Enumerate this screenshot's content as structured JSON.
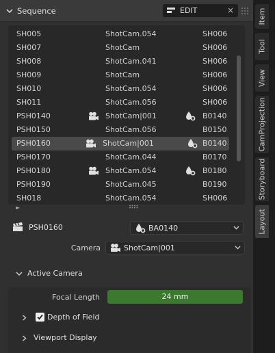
{
  "panel": {
    "title": "Sequence",
    "field_value": "EDIT",
    "field_clear": "×"
  },
  "list": {
    "rows": [
      {
        "shot": "SH005",
        "camera": "ShotCam.054",
        "bg": "SH006",
        "cam_icon": false,
        "bg_icon": false
      },
      {
        "shot": "SH007",
        "camera": "ShotCam",
        "bg": "SH006",
        "cam_icon": false,
        "bg_icon": false
      },
      {
        "shot": "SH008",
        "camera": "ShotCam.041",
        "bg": "SH006",
        "cam_icon": false,
        "bg_icon": false
      },
      {
        "shot": "SH009",
        "camera": "ShotCam",
        "bg": "SH006",
        "cam_icon": false,
        "bg_icon": false
      },
      {
        "shot": "SH010",
        "camera": "ShotCam.054",
        "bg": "SH006",
        "cam_icon": false,
        "bg_icon": false
      },
      {
        "shot": "SH011",
        "camera": "ShotCam.056",
        "bg": "SH006",
        "cam_icon": false,
        "bg_icon": false
      },
      {
        "shot": "PSH0140",
        "camera": "ShotCam|001",
        "bg": "B0140",
        "cam_icon": true,
        "bg_icon": true
      },
      {
        "shot": "PSH0150",
        "camera": "ShotCam.056",
        "bg": "B0150",
        "cam_icon": false,
        "bg_icon": false
      },
      {
        "shot": "PSH0160",
        "camera": "ShotCam|001",
        "bg": "B0140",
        "cam_icon": true,
        "bg_icon": true,
        "selected": true
      },
      {
        "shot": "PSH0170",
        "camera": "ShotCam.044",
        "bg": "B0170",
        "cam_icon": false,
        "bg_icon": false
      },
      {
        "shot": "PSH0180",
        "camera": "ShotCam.054",
        "bg": "B0180",
        "cam_icon": true,
        "bg_icon": true
      },
      {
        "shot": "PSH0190",
        "camera": "ShotCam.045",
        "bg": "B0190",
        "cam_icon": false,
        "bg_icon": false
      },
      {
        "shot": "SH018",
        "camera": "ShotCam.054",
        "bg": "SH006",
        "cam_icon": false,
        "bg_icon": false
      }
    ],
    "expand_arrow": "►"
  },
  "shot": {
    "name": "PSH0160",
    "background_value": "BA0140",
    "camera_label": "Camera",
    "camera_value": "ShotCam|001"
  },
  "active_camera": {
    "title": "Active Camera",
    "focal_length_label": "Focal Length",
    "focal_length_value": "24 mm",
    "dof_label": "Depth of Field",
    "dof_checked": true,
    "viewport_display_label": "Viewport Display"
  },
  "tabs": [
    "Item",
    "Tool",
    "View",
    "CamProjection",
    "Storyboard",
    "Layout"
  ],
  "active_tab": "Layout",
  "colors": {
    "panel_bg": "#303030",
    "list_bg": "#282828",
    "selected_row": "#4a4a4a",
    "slider_fill": "#3b7a2e"
  }
}
